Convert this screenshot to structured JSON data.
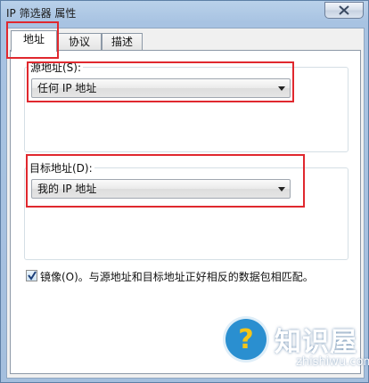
{
  "window": {
    "title": "IP 筛选器 属性"
  },
  "tabs": [
    {
      "label": "地址",
      "active": true
    },
    {
      "label": "协议",
      "active": false
    },
    {
      "label": "描述",
      "active": false
    }
  ],
  "source": {
    "group_label": "源地址(S):",
    "selected": "任何 IP 地址"
  },
  "destination": {
    "group_label": "目标地址(D):",
    "selected": "我的 IP 地址"
  },
  "mirror": {
    "checked": true,
    "label": "镜像(O)。与源地址和目标地址正好相反的数据包相匹配。"
  },
  "watermark": {
    "title": "知识屋",
    "url": "zhishiwu.com",
    "badge_glyph": "?"
  },
  "colors": {
    "highlight": "#e0282e",
    "title_bar": "#b9d1ea",
    "watermark_badge": "#2a8fd0"
  }
}
